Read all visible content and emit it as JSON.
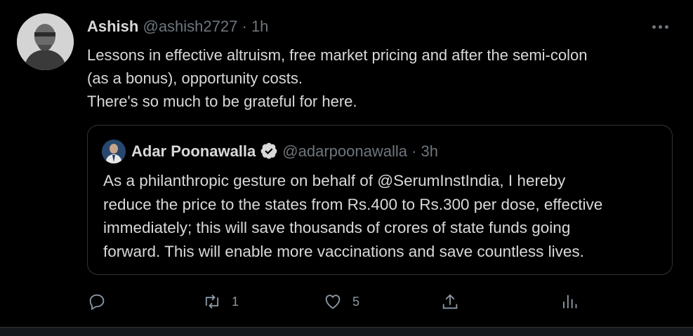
{
  "tweet": {
    "author_name": "Ashish",
    "author_handle": "@ashish2727",
    "separator": "·",
    "time": "1h",
    "text_lines": [
      "Lessons in effective altruism, free market pricing and after the semi-colon",
      "(as a bonus), opportunity costs.",
      "There's so much to be grateful for here."
    ]
  },
  "quote": {
    "author_name": "Adar Poonawalla",
    "author_handle": "@adarpoonawalla",
    "separator": "·",
    "time": "3h",
    "text_lines": [
      "As a philanthropic gesture on behalf of @SerumInstIndia, I hereby",
      "reduce the price to the states from Rs.400 to Rs.300 per dose, effective",
      "immediately; this will save thousands of crores of state funds going",
      "forward. This will enable more vaccinations and save countless lives."
    ]
  },
  "actions": {
    "retweet_count": "1",
    "like_count": "5"
  },
  "colors": {
    "background": "#000000",
    "text": "#d9d9d9",
    "secondary": "#6e767d",
    "verified": "#d9d9d9",
    "border": "#2f3336"
  },
  "icons": [
    "more-icon",
    "verified-badge-icon",
    "reply-icon",
    "retweet-icon",
    "like-icon",
    "share-icon",
    "analytics-icon"
  ]
}
